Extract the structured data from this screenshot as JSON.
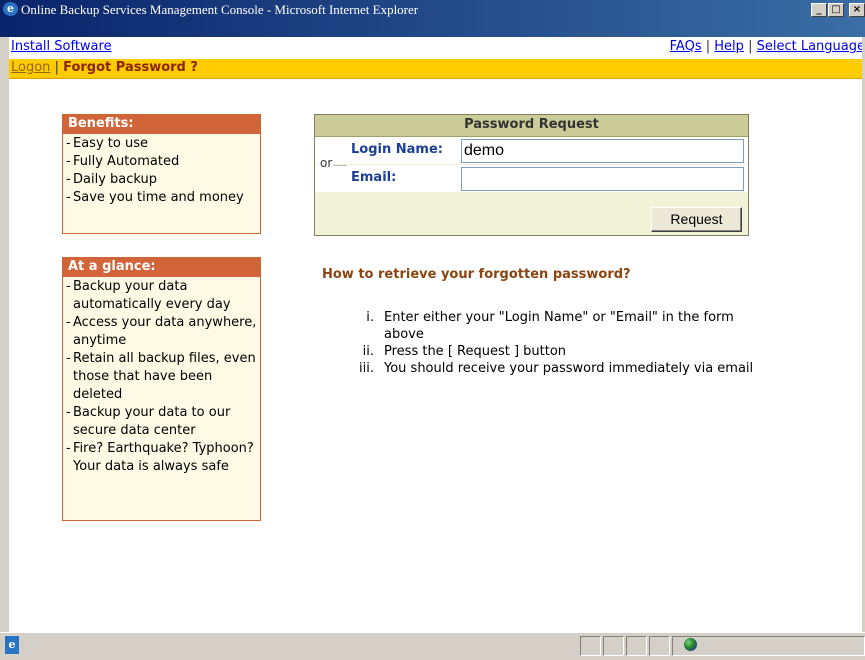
{
  "window": {
    "title": "Online Backup Services Management Console - Microsoft Internet Explorer",
    "icons": {
      "app": "ie-icon",
      "minimize": "minimize-icon",
      "maximize": "maximize-icon",
      "close": "close-icon"
    }
  },
  "topnav": {
    "install": "Install Software",
    "faqs": "FAQs",
    "help": "Help",
    "language": "Select Language",
    "separator": "|"
  },
  "subnav": {
    "logon": "Logon",
    "separator": "|",
    "current": "Forgot Password ?"
  },
  "benefits": {
    "title": "Benefits:",
    "items": [
      "Easy to use",
      "Fully Automated",
      "Daily backup",
      "Save you time and money"
    ]
  },
  "glance": {
    "title": "At a glance:",
    "items": [
      "Backup your data automatically every day",
      "Access your data anywhere, anytime",
      "Retain all backup files, even those that have been deleted",
      "Backup your data to our secure data center",
      "Fire? Earthquake? Typhoon? Your data is always safe"
    ]
  },
  "request": {
    "title": "Password Request",
    "login_label": "Login Name:",
    "login_value": "demo",
    "or": "or",
    "email_label": "Email:",
    "email_value": "",
    "button": "Request"
  },
  "howto": {
    "title": "How to retrieve your forgotten password?",
    "steps": [
      {
        "num": "i.",
        "text": "Enter either your \"Login Name\" or \"Email\" in the form above"
      },
      {
        "num": "ii.",
        "text": "Press the [ Request ] button"
      },
      {
        "num": "iii.",
        "text": "You should receive your password immediately via email"
      }
    ]
  },
  "statusbar": {
    "icons": {
      "page": "page-icon",
      "zone": "internet-globe-icon"
    }
  },
  "colors": {
    "titlebar": "#0a246a",
    "subnav_bg": "#ffcc00",
    "sidebox_header": "#d2643a",
    "sidebox_bg": "#fffae6",
    "request_header": "#cccc99",
    "request_bg": "#f2f2d9",
    "label_blue": "#1c3f95",
    "howto_title": "#8b4513"
  }
}
